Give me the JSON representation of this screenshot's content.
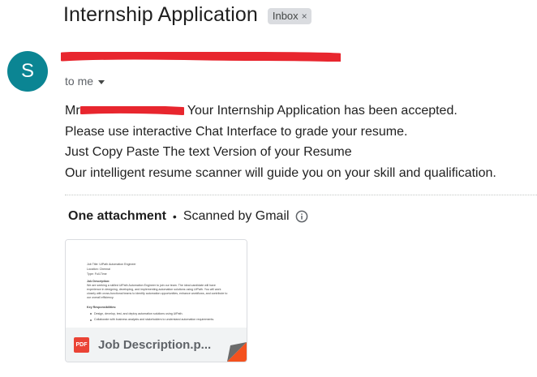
{
  "email": {
    "subject": "Internship Application",
    "label": "Inbox",
    "label_remove": "×",
    "avatar_letter": "S",
    "recipient": "to me",
    "body": {
      "salutation_prefix": "Mr",
      "line1_rest": " Your Internship Application has been accepted.",
      "line2": "Please use interactive Chat Interface to grade your resume.",
      "line3": "Just Copy Paste The text Version of your Resume",
      "line4": "Our intelligent resume scanner will guide you on your skill and qualification."
    }
  },
  "attachments": {
    "title": "One attachment",
    "separator": "•",
    "scan_status": "Scanned by Gmail",
    "file": {
      "name": "Job Description.p...",
      "type_badge": "PDF",
      "preview": {
        "job_title": "Job Title: UiPath Automation Engineer",
        "location": "Location: Chennai",
        "type": "Type: Full-Time",
        "section1": "Job Description:",
        "para1": "We are seeking a skilled UiPath Automation Engineer to join our team. The ideal candidate will have experience in designing, developing, and implementing automation solutions using UiPath. You will work closely with cross-functional teams to identify automation opportunities, enhance workflows, and contribute to our overall efficiency.",
        "section2": "Key Responsibilities:",
        "bullet1": "Design, develop, test, and deploy automation solutions using UiPath.",
        "bullet2": "Collaborate with business analysts and stakeholders to understand automation requirements."
      }
    }
  },
  "colors": {
    "avatar": "#0b8593",
    "redaction": "#e8262e",
    "pdf": "#ea4335"
  }
}
